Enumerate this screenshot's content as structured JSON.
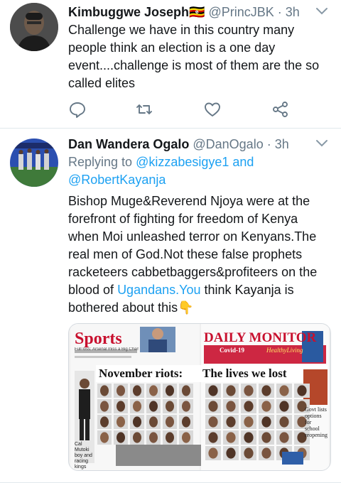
{
  "tweets": [
    {
      "author": "Kimbuggwe Joseph",
      "flag": "🇺🇬",
      "handle": "@PrincJBK",
      "separator": "·",
      "time": "3h",
      "text": "Challenge we have in this country many people think an election is a one day event....challenge is most of them are the so called elites"
    },
    {
      "author": "Dan Wandera Ogalo",
      "handle": "@DanOgalo",
      "separator": "·",
      "time": "3h",
      "reply_prefix": "Replying to ",
      "reply_to_1": "@kizzabesigye1",
      "reply_and": " and",
      "reply_to_2": "@RobertKayanja",
      "text_a": "Bishop Muge&Reverend Njoya were at the forefront of fighting for freedom of Kenya when Moi unleashed terror on Kenyans.The real men of God.Not these false prophets racketeers cabbetbaggers&profiteers on the blood of ",
      "text_link": "Ugandans.You",
      "text_b": " think Kayanja is bothered about this",
      "emoji": "👇",
      "image": {
        "left_masthead": "Sports",
        "left_sub": "Full loss: Arsenal miss a Big Chance",
        "right_masthead": "DAILY MONITOR",
        "covid": "Covid-19",
        "healthy": "HealthyLiving",
        "headline_left": "November riots:",
        "headline_right": "The lives we lost",
        "side_caption": "Cal Mutoki boy and racing kings",
        "right_caption": "Govt lists options for school reopening"
      }
    }
  ],
  "colors": {
    "name": "#14171a",
    "secondary": "#657786",
    "link": "#1da1f2",
    "divider": "#e1e8ed",
    "monitor_red": "#c8102e"
  },
  "icons": [
    "reply-icon",
    "retweet-icon",
    "like-icon",
    "share-icon",
    "chevron-down-icon"
  ]
}
